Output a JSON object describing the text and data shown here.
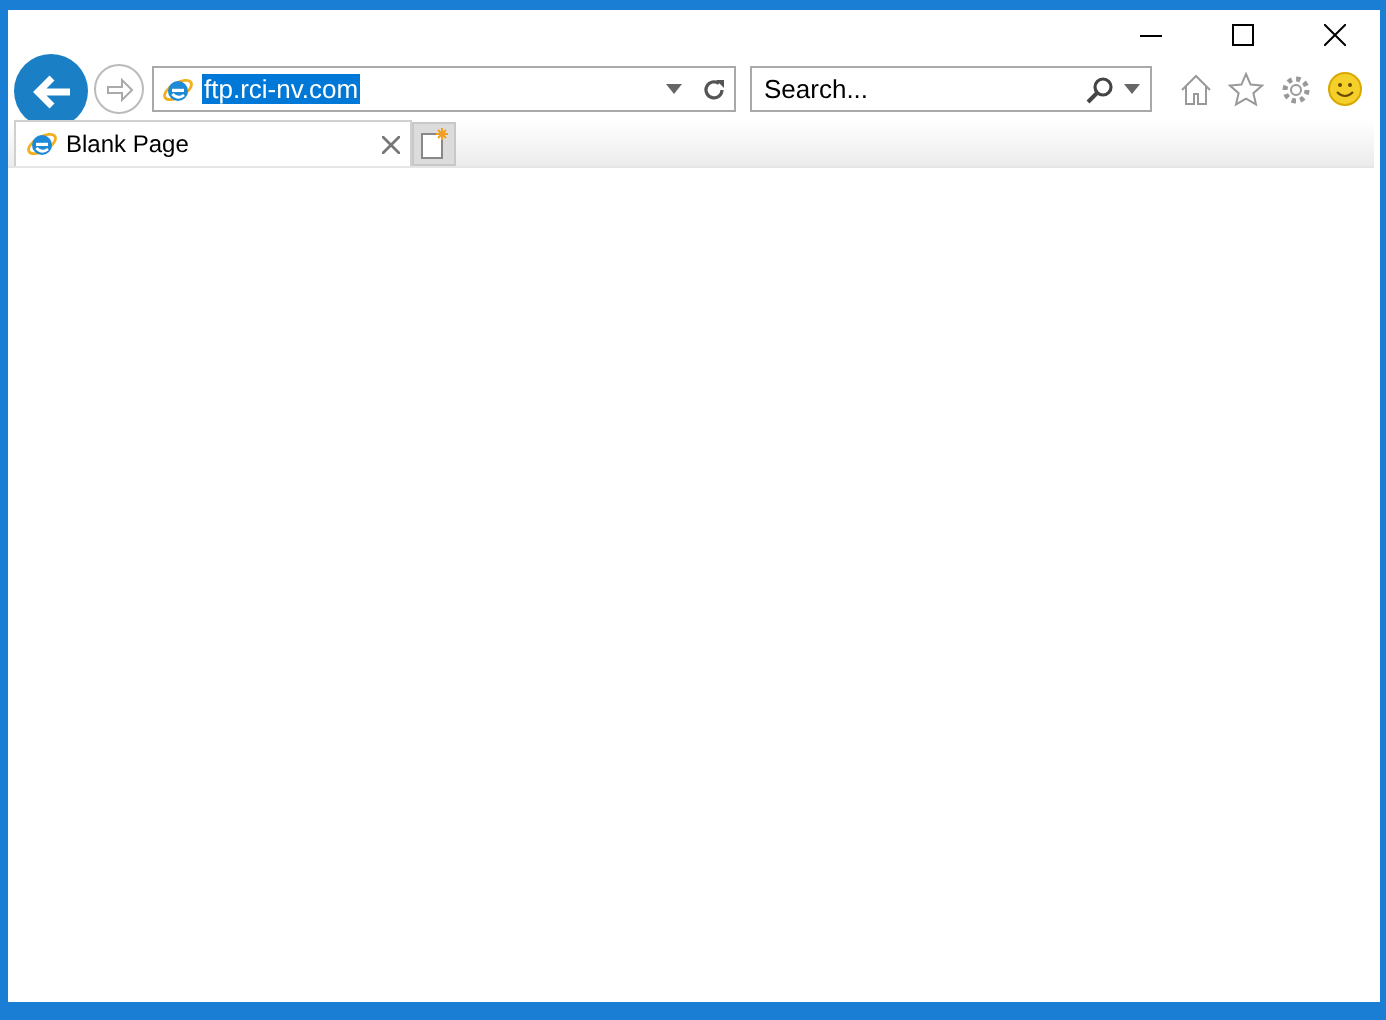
{
  "address_bar": {
    "value": "ftp.rci-nv.com",
    "text_selected": true
  },
  "search": {
    "placeholder": "Search..."
  },
  "tabs": [
    {
      "label": "Blank Page",
      "selected": true
    }
  ]
}
